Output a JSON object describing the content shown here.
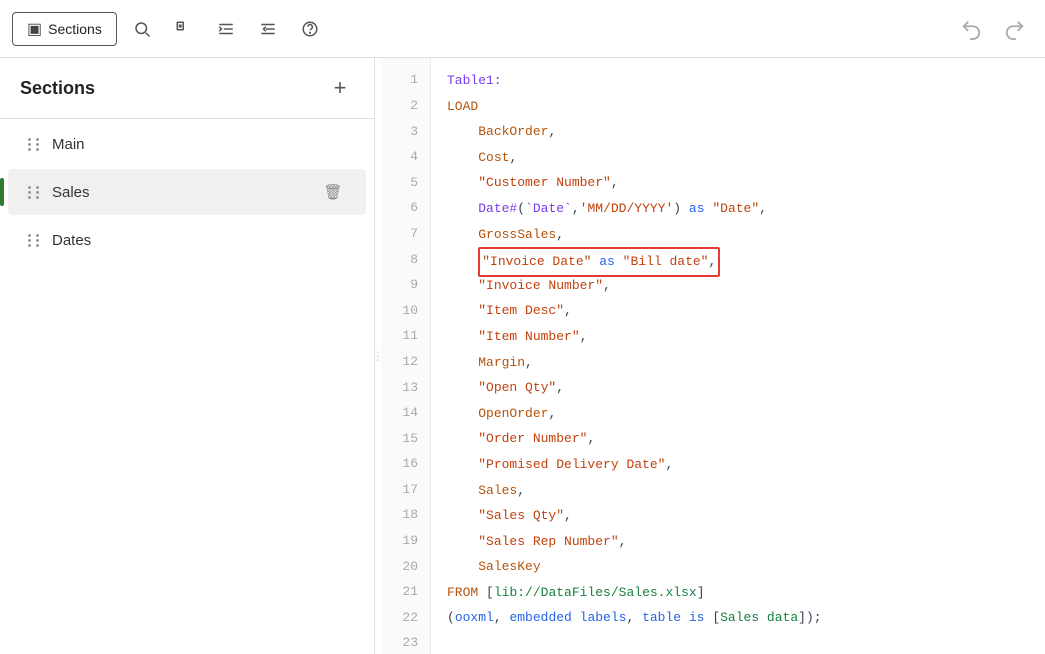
{
  "toolbar": {
    "sections_label": "Sections",
    "search_icon": "⌕",
    "comment_icon": "//",
    "indent_icon": "≡",
    "outdent_icon": "≡",
    "help_icon": "?",
    "undo_icon": "↩",
    "redo_icon": "↪"
  },
  "sidebar": {
    "title": "Sections",
    "add_label": "+",
    "items": [
      {
        "id": "main",
        "label": "Main",
        "active": false
      },
      {
        "id": "sales",
        "label": "Sales",
        "active": true
      },
      {
        "id": "dates",
        "label": "Dates",
        "active": false
      }
    ]
  },
  "code": {
    "lines": [
      {
        "num": 1,
        "content": "Table1:",
        "html": "<span class='c-label'>Table1:</span>"
      },
      {
        "num": 2,
        "content": "LOAD",
        "html": "<span class='c-keyword'>LOAD</span>"
      },
      {
        "num": 3,
        "content": "    BackOrder,",
        "html": "    <span class='c-field'>BackOrder</span><span class='c-plain'>,</span>"
      },
      {
        "num": 4,
        "content": "    Cost,",
        "html": "    <span class='c-field'>Cost</span><span class='c-plain'>,</span>"
      },
      {
        "num": 5,
        "content": "    \"Customer Number\",",
        "html": "    <span class='c-string'>\"Customer Number\"</span><span class='c-plain'>,</span>"
      },
      {
        "num": 6,
        "content": "    Date#(`Date`,'MM/DD/YYYY') as \"Date\",",
        "html": "    <span class='c-func'>Date#</span><span class='c-plain'>(</span><span class='c-label'>`Date`</span><span class='c-plain'>,</span><span class='c-string'>'MM/DD/YYYY'</span><span class='c-plain'>)</span> <span class='c-as'>as</span> <span class='c-string'>\"Date\"</span><span class='c-plain'>,</span>"
      },
      {
        "num": 7,
        "content": "    GrossSales,",
        "html": "    <span class='c-field'>GrossSales</span><span class='c-plain'>,</span>"
      },
      {
        "num": 8,
        "content": "    \"Invoice Date\" as \"Bill date\",",
        "html": "    <span class='highlighted-line'><span class='c-string'>\"Invoice Date\"</span> <span class='c-as'>as</span> <span class='c-string'>\"Bill date\"</span><span class='c-plain'>,</span></span>"
      },
      {
        "num": 9,
        "content": "    \"Invoice Number\",",
        "html": "    <span class='c-string'>\"Invoice Number\"</span><span class='c-plain'>,</span>"
      },
      {
        "num": 10,
        "content": "    \"Item Desc\",",
        "html": "    <span class='c-string'>\"Item Desc\"</span><span class='c-plain'>,</span>"
      },
      {
        "num": 11,
        "content": "    \"Item Number\",",
        "html": "    <span class='c-string'>\"Item Number\"</span><span class='c-plain'>,</span>"
      },
      {
        "num": 12,
        "content": "    Margin,",
        "html": "    <span class='c-field'>Margin</span><span class='c-plain'>,</span>"
      },
      {
        "num": 13,
        "content": "    \"Open Qty\",",
        "html": "    <span class='c-string'>\"Open Qty\"</span><span class='c-plain'>,</span>"
      },
      {
        "num": 14,
        "content": "    OpenOrder,",
        "html": "    <span class='c-field'>OpenOrder</span><span class='c-plain'>,</span>"
      },
      {
        "num": 15,
        "content": "    \"Order Number\",",
        "html": "    <span class='c-string'>\"Order Number\"</span><span class='c-plain'>,</span>"
      },
      {
        "num": 16,
        "content": "    \"Promised Delivery Date\",",
        "html": "    <span class='c-string'>\"Promised Delivery Date\"</span><span class='c-plain'>,</span>"
      },
      {
        "num": 17,
        "content": "    Sales,",
        "html": "    <span class='c-field'>Sales</span><span class='c-plain'>,</span>"
      },
      {
        "num": 18,
        "content": "    \"Sales Qty\",",
        "html": "    <span class='c-string'>\"Sales Qty\"</span><span class='c-plain'>,</span>"
      },
      {
        "num": 19,
        "content": "    \"Sales Rep Number\",",
        "html": "    <span class='c-string'>\"Sales Rep Number\"</span><span class='c-plain'>,</span>"
      },
      {
        "num": 20,
        "content": "    SalesKey",
        "html": "    <span class='c-field'>SalesKey</span>"
      },
      {
        "num": 21,
        "content": "FROM [lib://DataFiles/Sales.xlsx]",
        "html": "<span class='c-keyword'>FROM</span> <span class='c-bracket'>[</span><span class='c-path'>lib://DataFiles/Sales.xlsx</span><span class='c-bracket'>]</span>"
      },
      {
        "num": 22,
        "content": "(ooxml, embedded labels, table is [Sales data]);",
        "html": "<span class='c-plain'>(</span><span class='c-as'>ooxml</span><span class='c-plain'>, </span><span class='c-as'>embedded labels</span><span class='c-plain'>, </span><span class='c-as'>table is</span><span class='c-plain'> </span><span class='c-bracket'>[</span><span class='c-path'>Sales data</span><span class='c-bracket'>]</span><span class='c-plain'>);</span>"
      },
      {
        "num": 23,
        "content": "",
        "html": ""
      }
    ]
  }
}
